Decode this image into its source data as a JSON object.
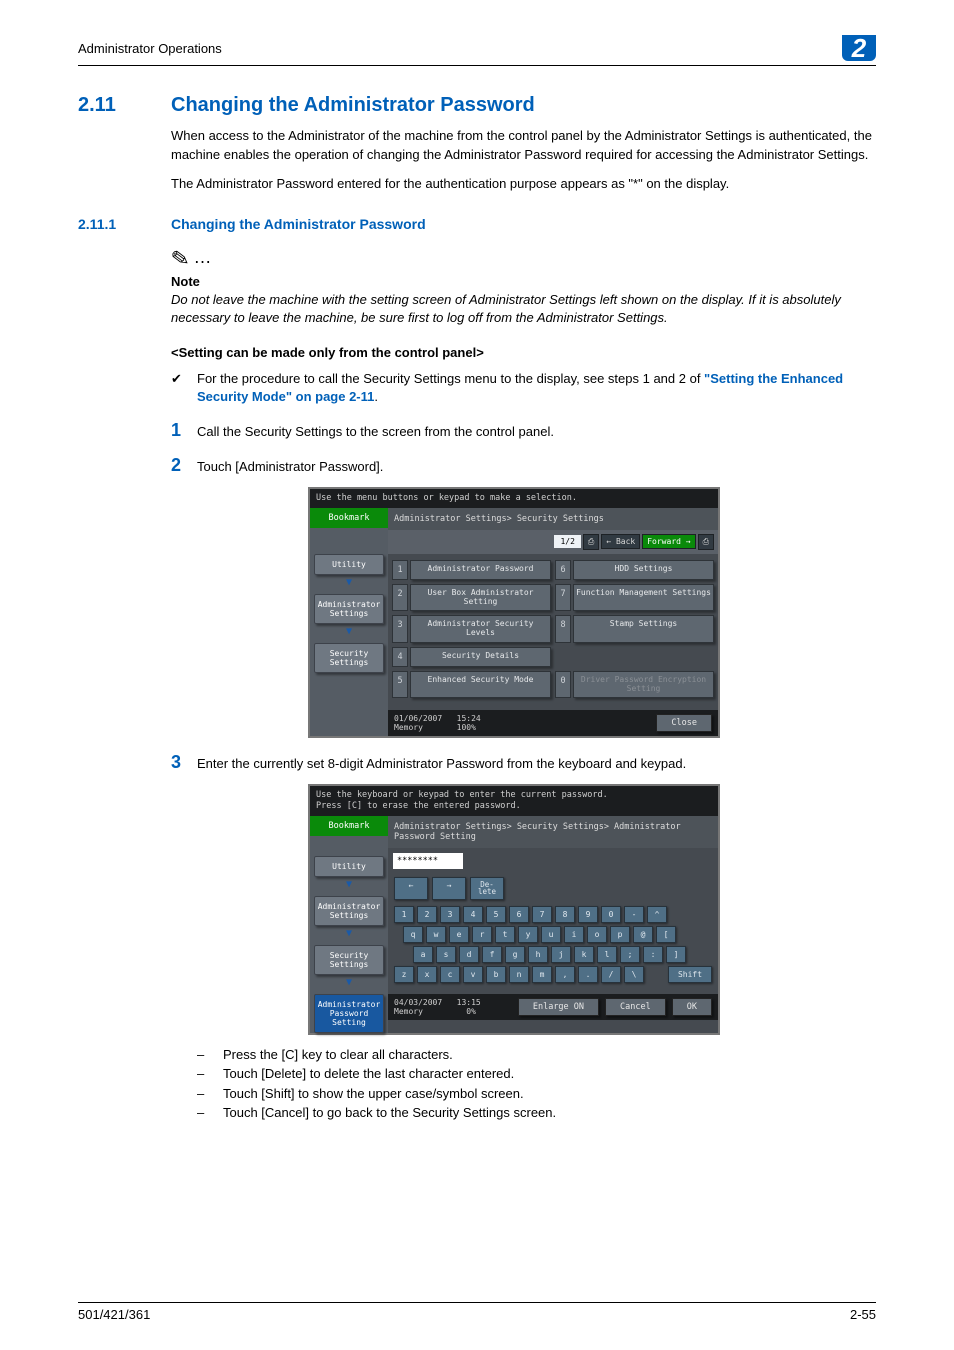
{
  "header": {
    "title": "Administrator Operations",
    "section_number": "2"
  },
  "h1": {
    "num": "2.11",
    "text": "Changing the Administrator Password"
  },
  "intro1": "When access to the Administrator of the machine from the control panel by the Administrator Settings is authenticated, the machine enables the operation of changing the Administrator Password required for accessing the Administrator Settings.",
  "intro2": "The Administrator Password entered for the authentication purpose appears as \"*\" on the display.",
  "h2": {
    "num": "2.11.1",
    "text": "Changing the Administrator Password"
  },
  "note": {
    "label": "Note",
    "text": "Do not leave the machine with the setting screen of Administrator Settings left shown on the display. If it is absolutely necessary to leave the machine, be sure first to log off from the Administrator Settings."
  },
  "subhead": "<Setting can be made only from the control panel>",
  "proc_intro_a": "For the procedure to call the Security Settings menu to the display, see steps 1 and 2 of ",
  "proc_link": "\"Setting the Enhanced Security Mode\" on page 2-11",
  "proc_period": ".",
  "steps": {
    "s1": {
      "n": "1",
      "t": "Call the Security Settings to the screen from the control panel."
    },
    "s2": {
      "n": "2",
      "t": "Touch [Administrator Password]."
    },
    "s3": {
      "n": "3",
      "t": "Enter the currently set 8-digit Administrator Password from the keyboard and keypad."
    }
  },
  "sub_bullets": [
    "Press the [C] key to clear all characters.",
    "Touch [Delete] to delete the last character entered.",
    "Touch [Shift] to show the upper case/symbol screen.",
    "Touch [Cancel] to go back to the Security Settings screen."
  ],
  "panel1": {
    "top": "Use the menu buttons or keypad to make a selection.",
    "bookmark": "Bookmark",
    "crumbs": [
      "Utility",
      "Administrator Settings",
      "Security Settings"
    ],
    "breadcrumb": "Administrator Settings> Security Settings",
    "page": "1/2",
    "back": "Back",
    "forward": "Forward",
    "icon_left": "⎙",
    "icon_right": "⎙",
    "items": [
      {
        "n": "1",
        "l": "Administrator Password"
      },
      {
        "n": "6",
        "l": "HDD Settings"
      },
      {
        "n": "2",
        "l": "User Box Administrator Setting"
      },
      {
        "n": "7",
        "l": "Function Management Settings"
      },
      {
        "n": "3",
        "l": "Administrator Security Levels"
      },
      {
        "n": "8",
        "l": "Stamp Settings"
      },
      {
        "n": "4",
        "l": "Security Details"
      },
      {
        "n": "",
        "l": ""
      },
      {
        "n": "5",
        "l": "Enhanced Security Mode"
      },
      {
        "n": "0",
        "l": "Driver Password Encryption Setting",
        "off": true
      }
    ],
    "foot_date": "01/06/2007",
    "foot_time": "15:24",
    "foot_mem": "Memory",
    "foot_mem_v": "100%",
    "close": "Close"
  },
  "panel2": {
    "top1": "Use the keyboard or keypad to enter the current password.",
    "top2": "Press [C] to erase the entered password.",
    "bookmark": "Bookmark",
    "crumbs": [
      "Utility",
      "Administrator Settings",
      "Security Settings",
      "Administrator Password Setting"
    ],
    "breadcrumb": "Administrator Settings> Security Settings> Administrator Password Setting",
    "input": "********",
    "nav_left": "←",
    "nav_right": "→",
    "delete": "De- lete",
    "rows": {
      "r1": [
        "1",
        "2",
        "3",
        "4",
        "5",
        "6",
        "7",
        "8",
        "9",
        "0",
        "-",
        "^"
      ],
      "r2": [
        "q",
        "w",
        "e",
        "r",
        "t",
        "y",
        "u",
        "i",
        "o",
        "p",
        "@",
        "["
      ],
      "r3": [
        "a",
        "s",
        "d",
        "f",
        "g",
        "h",
        "j",
        "k",
        "l",
        ";",
        ":",
        "]"
      ],
      "r4": [
        "z",
        "x",
        "c",
        "v",
        "b",
        "n",
        "m",
        ",",
        ".",
        "/",
        "\\"
      ]
    },
    "shift": "Shift",
    "foot_date": "04/03/2007",
    "foot_time": "13:15",
    "foot_mem": "Memory",
    "foot_mem_v": "0%",
    "enlarge": "Enlarge ON",
    "cancel": "Cancel",
    "ok": "OK"
  },
  "footer": {
    "model": "501/421/361",
    "page": "2-55"
  }
}
